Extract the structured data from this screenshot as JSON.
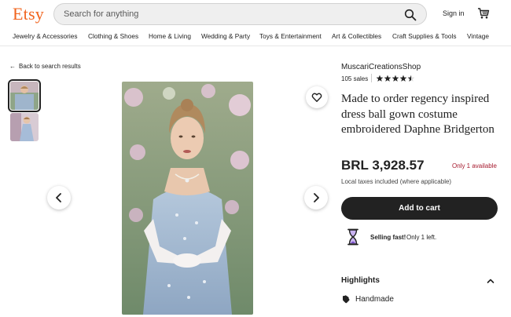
{
  "header": {
    "logo": "Etsy",
    "search_placeholder": "Search for anything",
    "signin": "Sign in"
  },
  "categories": [
    "Jewelry & Accessories",
    "Clothing & Shoes",
    "Home & Living",
    "Wedding & Party",
    "Toys & Entertainment",
    "Art & Collectibles",
    "Craft Supplies & Tools",
    "Vintage"
  ],
  "back_link": "Back to search results",
  "listing": {
    "shop_name": "MuscariCreationsShop",
    "sales": "105 sales",
    "rating": 4.5,
    "title": "Made to order regency inspired dress ball gown costume embroidered Daphne Bridgerton",
    "price": "BRL 3,928.57",
    "availability": "Only 1 available",
    "taxes": "Local taxes included (where applicable)",
    "add_to_cart": "Add to cart",
    "selling_fast_bold": "Selling fast!",
    "selling_fast_rest": "Only 1 left."
  },
  "highlights": {
    "title": "Highlights",
    "items": [
      "Handmade"
    ]
  },
  "colors": {
    "brand": "#f1641e",
    "button": "#222222",
    "availability": "#a61a2e"
  }
}
